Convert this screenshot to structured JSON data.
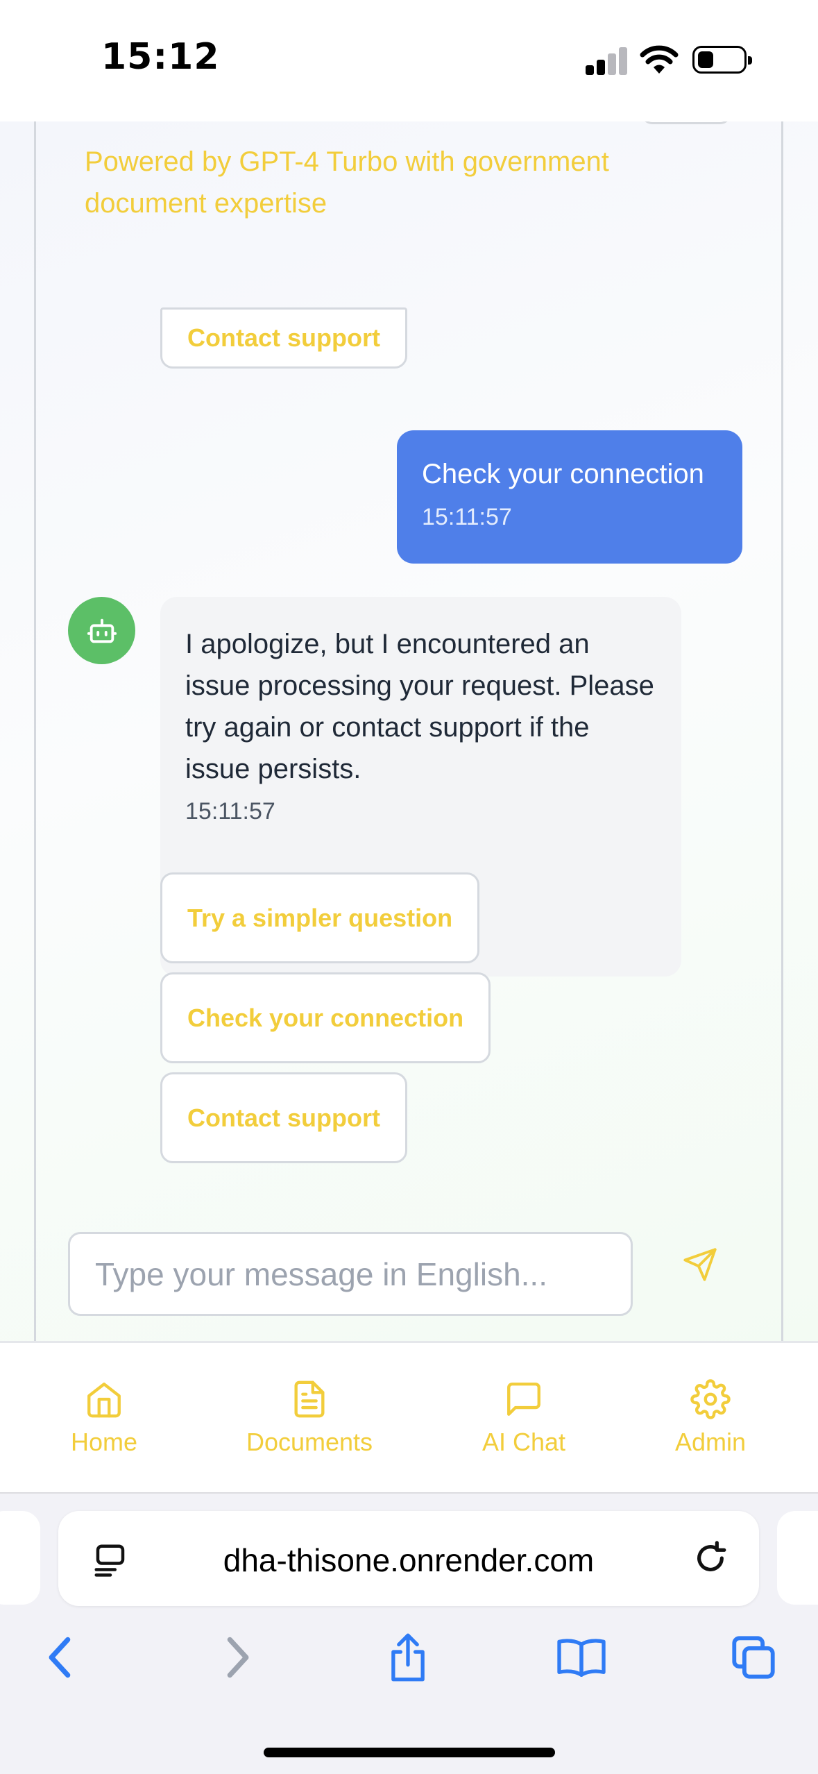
{
  "status_bar": {
    "time": "15:12"
  },
  "chat": {
    "tagline": "Powered by GPT-4 Turbo with government document expertise",
    "prev_suggestion": "Contact support",
    "user_message": {
      "text": "Check your connection",
      "time": "15:11:57"
    },
    "bot_message": {
      "text": "I apologize, but I encountered an issue processing your request. Please try again or contact support if the issue persists.",
      "time": "15:11:57"
    },
    "suggestions": [
      "Try a simpler question",
      "Check your connection",
      "Contact support"
    ],
    "composer": {
      "placeholder": "Type your message in English...",
      "value": ""
    }
  },
  "nav": {
    "items": [
      {
        "label": "Home",
        "icon": "home-icon"
      },
      {
        "label": "Documents",
        "icon": "document-icon"
      },
      {
        "label": "AI Chat",
        "icon": "chat-bubble-icon"
      },
      {
        "label": "Admin",
        "icon": "gear-icon"
      }
    ]
  },
  "browser": {
    "url": "dha-thisone.onrender.com"
  },
  "colors": {
    "accent_yellow": "#f2cd3b",
    "user_bubble": "#4f7fe9",
    "bot_avatar": "#5cbf67",
    "ios_blue": "#2f7bf5"
  }
}
